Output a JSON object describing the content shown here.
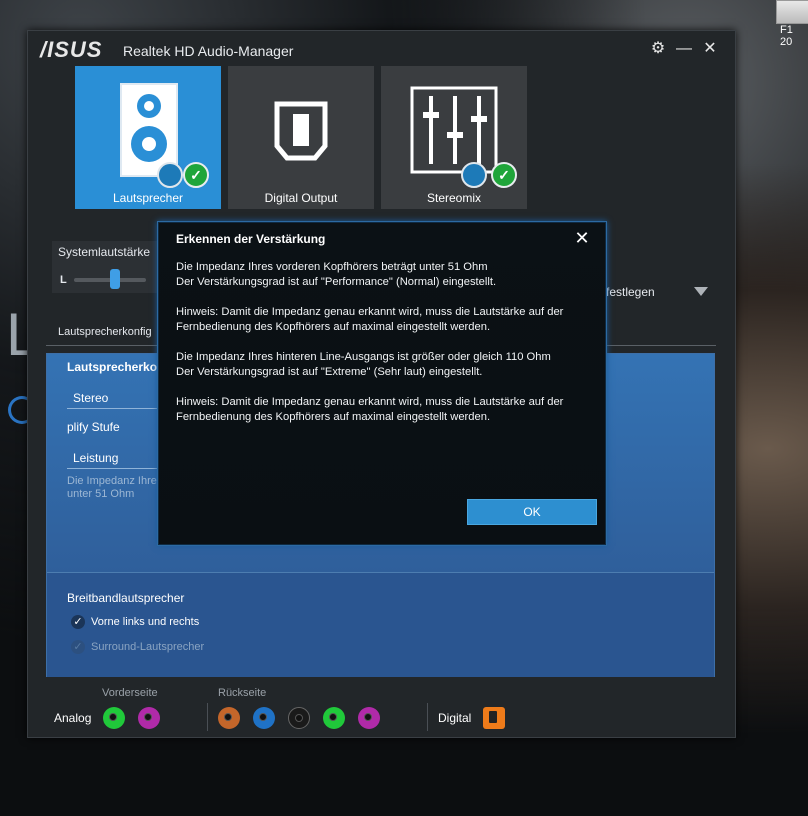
{
  "desktop": {
    "icon_label": "F1 20"
  },
  "window": {
    "logo": "/ISUS",
    "title": "Realtek HD Audio-Manager",
    "buttons": {
      "settings": "⚙",
      "minimize": "—",
      "close": "✕"
    }
  },
  "devices": [
    {
      "label": "Lautsprecher",
      "icon": "speaker-icon",
      "active": true
    },
    {
      "label": "Digital Output",
      "icon": "digital-output-icon",
      "active": false
    },
    {
      "label": "Stereomix",
      "icon": "mixer-icon",
      "active": false
    }
  ],
  "system_volume": {
    "label": "Systemlautstärke",
    "channel": "L",
    "level": 0.5
  },
  "preset": {
    "text": "festlegen"
  },
  "tabs": {
    "active": "Lautsprecherkonfig"
  },
  "panel": {
    "title": "Lautsprecherkon",
    "config_value": "Stereo",
    "amplify_label": "plify Stufe",
    "amplify_value": "Leistung",
    "note_line1": "Die Impedanz Ihre",
    "note_line2": "unter 51 Ohm",
    "lower_title": "Breitbandlautsprecher",
    "options": [
      {
        "label": "Vorne links und rechts",
        "checked": true,
        "enabled": true
      },
      {
        "label": "Surround-Lautsprecher",
        "checked": true,
        "enabled": false
      }
    ]
  },
  "jacks": {
    "front_label": "Vorderseite",
    "rear_label": "Rückseite",
    "analog_label": "Analog",
    "digital_label": "Digital",
    "front": [
      "#20c93a",
      "#b02aa8"
    ],
    "rear": [
      "#c4662a",
      "#1f72c6",
      "#1a1a1a",
      "#20c93a",
      "#b02aa8"
    ],
    "digital_color": "#ee7b1a"
  },
  "dialog": {
    "title": "Erkennen der Verstärkung",
    "paragraphs": [
      "Die Impedanz Ihres vorderen Kopfhörers beträgt unter 51 Ohm\nDer Verstärkungsgrad ist auf \"Performance\" (Normal) eingestellt.",
      "Hinweis: Damit die Impedanz genau erkannt wird, muss die Lautstärke auf der Fernbedienung des Kopfhörers auf maximal eingestellt werden.",
      "Die Impedanz Ihres hinteren Line-Ausgangs ist größer oder gleich 110 Ohm\nDer Verstärkungsgrad ist auf \"Extreme\" (Sehr laut) eingestellt.",
      "Hinweis: Damit die Impedanz genau erkannt wird, muss die Lautstärke auf der Fernbedienung des Kopfhörers auf maximal eingestellt werden."
    ],
    "ok_label": "OK",
    "close_glyph": "✕"
  }
}
